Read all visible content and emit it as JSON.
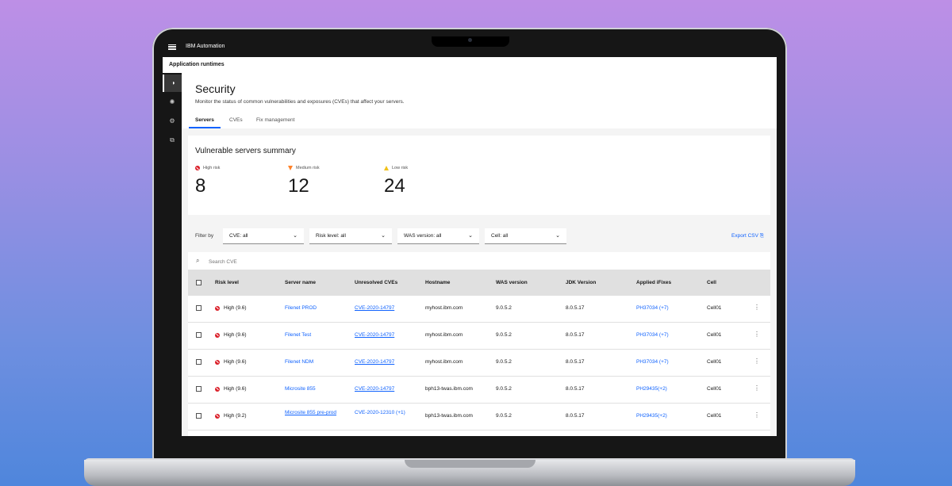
{
  "app": {
    "brand": "IBM Automation",
    "section": "Application runtimes"
  },
  "page": {
    "title": "Security",
    "description": "Monitor the status of common vulnerabilities and exposures (CVEs) that affect your servers.",
    "tabs": [
      "Servers",
      "CVEs",
      "Fix management"
    ]
  },
  "summary": {
    "title": "Vulnerable servers summary",
    "metrics": [
      {
        "label": "High risk",
        "value": "8",
        "icon": "high-risk-icon",
        "color": "#da1e28"
      },
      {
        "label": "Medium risk",
        "value": "12",
        "icon": "medium-risk-icon",
        "color": "#ff832b"
      },
      {
        "label": "Low risk",
        "value": "24",
        "icon": "low-risk-icon",
        "color": "#f1c21b"
      }
    ]
  },
  "filters": {
    "label": "Filter by",
    "items": [
      "CVE: all",
      "Risk level: all",
      "WAS version: all",
      "Cell: all"
    ],
    "export": "Export CSV"
  },
  "search": {
    "placeholder": "Search CVE"
  },
  "table": {
    "headers": [
      "Risk level",
      "Server name",
      "Unresolved CVEs",
      "Hostname",
      "WAS version",
      "JDK Version",
      "Applied iFixes",
      "Cell"
    ],
    "rows": [
      {
        "risk": "High (9.6)",
        "server": "Filenet PROD",
        "cve": "CVE-2020-14797",
        "host": "myhost.ibm.com",
        "was": "9.0.5.2",
        "jdk": "8.0.5.17",
        "ifix": "PH37034 (+7)",
        "cell": "Cell01"
      },
      {
        "risk": "High (9.6)",
        "server": "Filenet Test",
        "cve": "CVE-2020-14797",
        "host": "myhost.ibm.com",
        "was": "9.0.5.2",
        "jdk": "8.0.5.17",
        "ifix": "PH37034 (+7)",
        "cell": "Cell01"
      },
      {
        "risk": "High (9.6)",
        "server": "Filenet NDM",
        "cve": "CVE-2020-14797",
        "host": "myhost.ibm.com",
        "was": "9.0.5.2",
        "jdk": "8.0.5.17",
        "ifix": "PH37034 (+7)",
        "cell": "Cell01"
      },
      {
        "risk": "High (9.6)",
        "server": "Microsite 855",
        "cve": "CVE-2020-14797",
        "host": "bph13-twas.ibm.com",
        "was": "9.0.5.2",
        "jdk": "8.0.5.17",
        "ifix": "PH29435(+2)",
        "cell": "Cell01"
      },
      {
        "risk": "High (9.2)",
        "server": "Microsite 855 pre-prod",
        "cve": "CVE-2020-12310 (+1)",
        "host": "bph13-twas.ibm.com",
        "was": "9.0.5.2",
        "jdk": "8.0.5.17",
        "ifix": "PH29435(+2)",
        "cell": "Cell01"
      }
    ]
  },
  "colors": {
    "accent": "#0f62fe",
    "high": "#da1e28",
    "medium": "#ff832b",
    "low": "#f1c21b"
  }
}
